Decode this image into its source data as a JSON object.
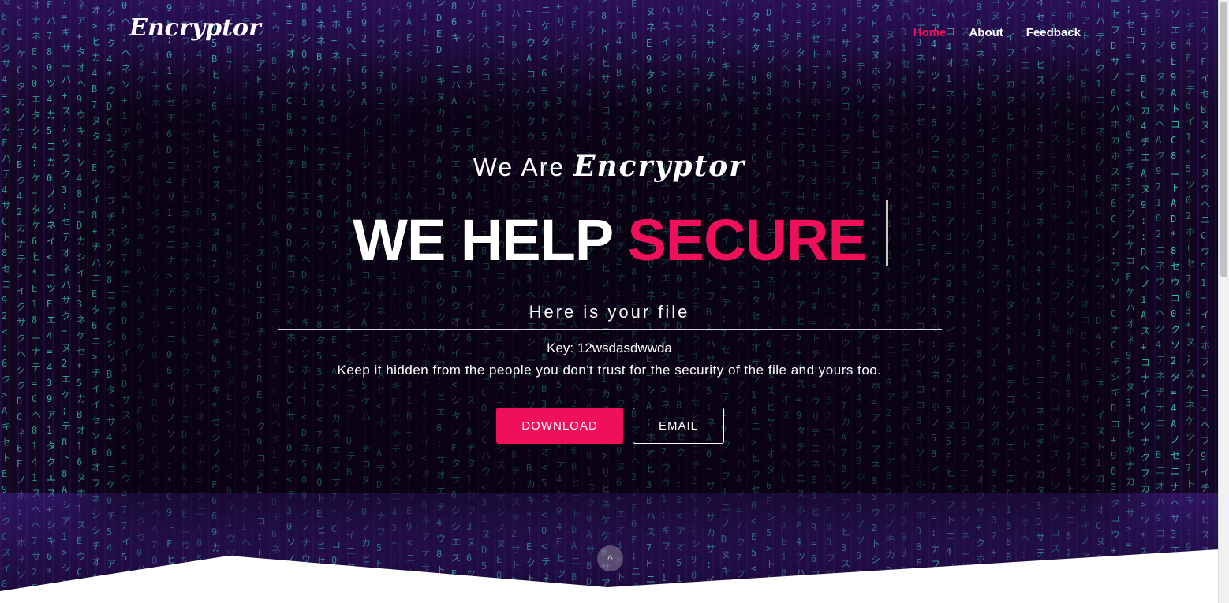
{
  "brand": {
    "logo": "Encryptor"
  },
  "nav": {
    "items": [
      "Home",
      "About",
      "Feedback"
    ],
    "active": "Home"
  },
  "hero": {
    "pretitle": "We Are",
    "pretitle_brand": "Encryptor",
    "headline_main": "WE HELP",
    "headline_accent": "SECURE"
  },
  "result": {
    "title": "Here is your file",
    "key_label": "Key:",
    "key_value": "12wsdasdwwda",
    "warning": "Keep it hidden from the people you don't trust for the security of the file and yours too."
  },
  "actions": {
    "download_label": "DOWNLOAD",
    "email_label": "EMAIL"
  },
  "scroll_top": {
    "icon": "chevron-up-icon",
    "glyph": "^"
  },
  "colors": {
    "accent": "#f0105a",
    "text": "#ffffff",
    "matrix_green": "#3ee6c5",
    "purple": "#3c1478"
  }
}
